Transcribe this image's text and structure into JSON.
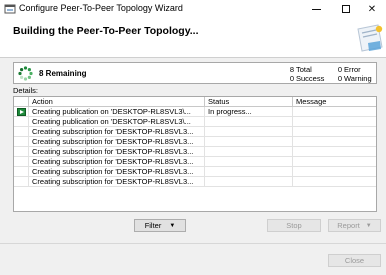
{
  "window": {
    "title": "Configure Peer-To-Peer Topology Wizard",
    "minimize_glyph": "",
    "maximize_glyph": "",
    "close_glyph": "✕"
  },
  "header": {
    "heading": "Building the Peer-To-Peer Topology..."
  },
  "summary": {
    "remaining_label": "8  Remaining",
    "total_count": "8",
    "total_label": "Total",
    "success_count": "0",
    "success_label": "Success",
    "error_count": "0",
    "error_label": "Error",
    "warning_count": "0",
    "warning_label": "Warning"
  },
  "details": {
    "label": "Details:",
    "columns": [
      "Action",
      "Status",
      "Message"
    ],
    "rows": [
      {
        "action": "Creating publication on 'DESKTOP-RL8SVL3\\...",
        "status": "In progress...",
        "message": "",
        "current": true
      },
      {
        "action": "Creating publication on 'DESKTOP-RL8SVL3\\...",
        "status": "",
        "message": ""
      },
      {
        "action": "Creating subscription for 'DESKTOP-RL8SVL3...",
        "status": "",
        "message": ""
      },
      {
        "action": "Creating subscription for 'DESKTOP-RL8SVL3...",
        "status": "",
        "message": ""
      },
      {
        "action": "Creating subscription for 'DESKTOP-RL8SVL3...",
        "status": "",
        "message": ""
      },
      {
        "action": "Creating subscription for 'DESKTOP-RL8SVL3...",
        "status": "",
        "message": ""
      },
      {
        "action": "Creating subscription for 'DESKTOP-RL8SVL3...",
        "status": "",
        "message": ""
      },
      {
        "action": "Creating subscription for 'DESKTOP-RL8SVL3...",
        "status": "",
        "message": ""
      }
    ]
  },
  "buttons": {
    "filter": "Filter",
    "stop": "Stop",
    "report": "Report",
    "close": "Close"
  },
  "colors": {
    "accent_green": "#1f8a3c",
    "window_bg": "#f0f0f0"
  }
}
